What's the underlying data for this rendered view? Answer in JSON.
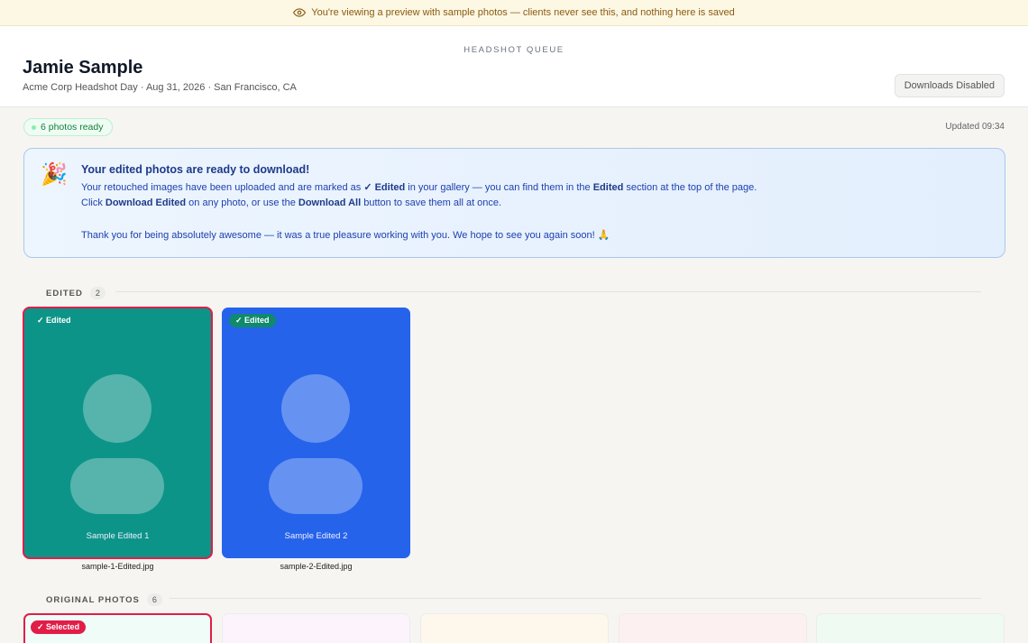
{
  "banner": {
    "icon": "eye-icon",
    "text": "You're viewing a preview with sample photos — clients never see this, and nothing here is saved"
  },
  "header": {
    "kicker": "HEADSHOT QUEUE",
    "title": "Jamie Sample",
    "subtitle": "Acme Corp Headshot Day · Aug 31, 2026 · San Francisco, CA",
    "downloads_button": "Downloads Disabled"
  },
  "status": {
    "ready_badge": "6 photos ready",
    "updated": "Updated 09:34"
  },
  "notice": {
    "emoji": "🎉",
    "title": "Your edited photos are ready to download!",
    "line1_a": "Your retouched images have been uploaded and are marked as ",
    "line1_b": "✓ Edited",
    "line1_c": " in your gallery — you can find them in the ",
    "line1_d": "Edited",
    "line1_e": " section at the top of the page.",
    "line2_a": "Click ",
    "line2_b": "Download Edited",
    "line2_c": " on any photo, or use the ",
    "line2_d": "Download All",
    "line2_e": " button to save them all at once.",
    "line3": "Thank you for being absolutely awesome — it was a true pleasure working with you. We hope to see you again soon! 🙏"
  },
  "edited_section": {
    "label": "EDITED",
    "count": "2",
    "photos": [
      {
        "tag": "✓ Edited",
        "caption": "Sample Edited 1",
        "filename": "sample-1-Edited.jpg",
        "color": "#0d9488",
        "selected": true
      },
      {
        "tag": "✓ Edited",
        "caption": "Sample Edited 2",
        "filename": "sample-2-Edited.jpg",
        "color": "#2563eb",
        "selected": false
      }
    ]
  },
  "originals_section": {
    "label": "ORIGINAL PHOTOS",
    "count": "6",
    "selected_tag": "✓ Selected",
    "tile_colors": [
      "#effcf8",
      "#fcf3fd",
      "#fdf7ec",
      "#fdf0f0",
      "#effaf2"
    ]
  },
  "colors": {
    "accent_selected": "#e11d48",
    "edited_tag": "#0f8a6c"
  }
}
